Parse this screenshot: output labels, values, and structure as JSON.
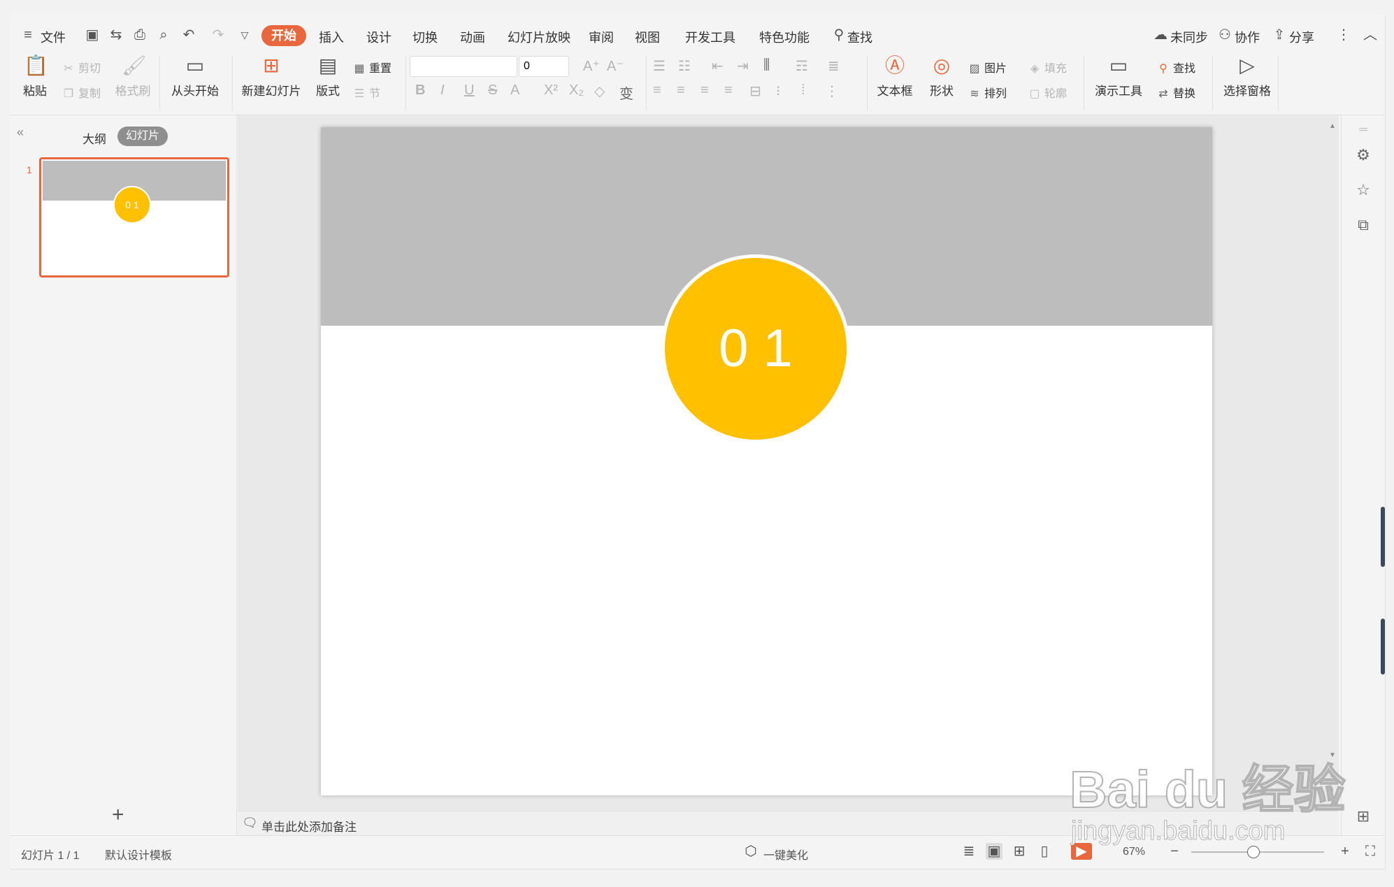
{
  "menubar": {
    "file_label": "文件",
    "tabs": [
      {
        "label": "开始",
        "active": true
      },
      {
        "label": "插入"
      },
      {
        "label": "设计"
      },
      {
        "label": "切换"
      },
      {
        "label": "动画"
      },
      {
        "label": "幻灯片放映"
      },
      {
        "label": "审阅"
      },
      {
        "label": "视图"
      },
      {
        "label": "开发工具"
      },
      {
        "label": "特色功能"
      }
    ],
    "search_label": "查找",
    "sync_label": "未同步",
    "collab_label": "协作",
    "share_label": "分享"
  },
  "ribbon": {
    "paste": "粘贴",
    "cut": "剪切",
    "copy": "复制",
    "format_painter": "格式刷",
    "from_start": "从头开始",
    "new_slide": "新建幻灯片",
    "layout": "版式",
    "reset": "重置",
    "section": "节",
    "font_name_value": "",
    "font_size_value": "0",
    "textbox": "文本框",
    "shape": "形状",
    "picture": "图片",
    "fill": "填充",
    "arrange": "排列",
    "outline": "轮廓",
    "presentation_tools": "演示工具",
    "find": "查找",
    "replace": "替换",
    "selection_pane": "选择窗格"
  },
  "leftpanel": {
    "outline_tab": "大纲",
    "slides_tab": "幻灯片",
    "slide_number": "1",
    "thumb_text": "0 1"
  },
  "slide": {
    "circle_text": "0 1",
    "colors": {
      "band": "#bdbdbd",
      "circle": "#ffc000"
    }
  },
  "notes": {
    "placeholder": "单击此处添加备注"
  },
  "statusbar": {
    "slide_count": "幻灯片 1 / 1",
    "template": "默认设计模板",
    "beautify": "一键美化",
    "zoom": "67%"
  },
  "watermark": {
    "line1": "Bai du 经验",
    "line2": "jingyan.baidu.com"
  },
  "colors": {
    "accent": "#e8673c",
    "yellow": "#ffc000"
  }
}
